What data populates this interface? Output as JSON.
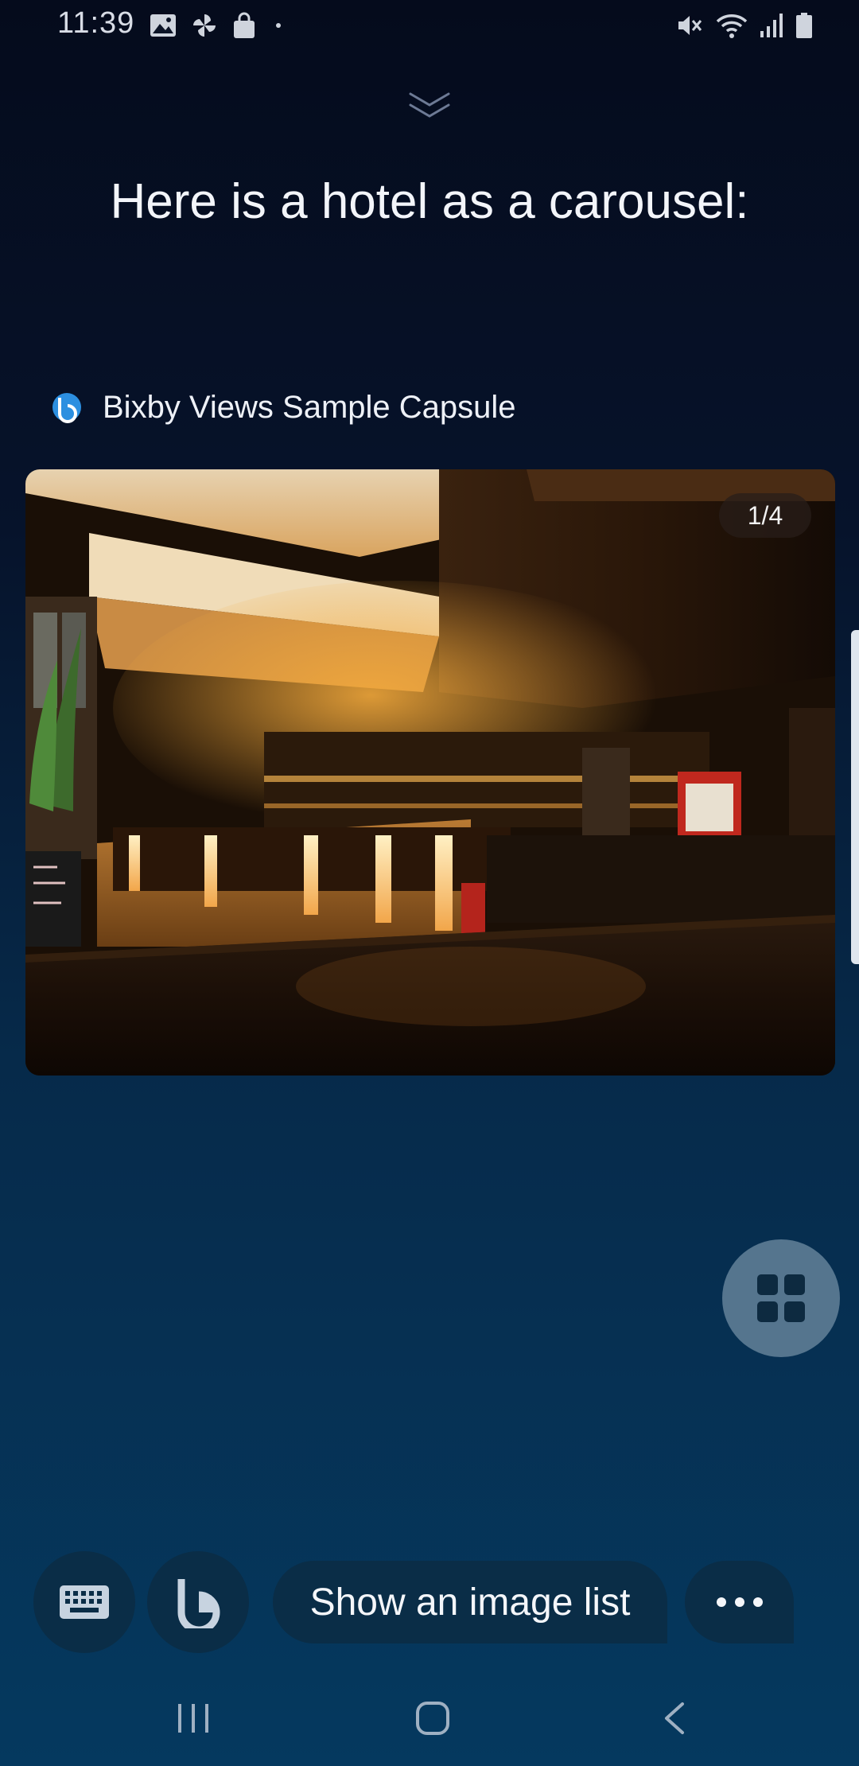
{
  "status_bar": {
    "time": "11:39",
    "left_icons": [
      "gallery-icon",
      "pinwheel-icon",
      "shopping-bag-icon",
      "dot-icon"
    ],
    "right_icons": [
      "mute-icon",
      "wifi-icon",
      "signal-icon",
      "battery-icon"
    ]
  },
  "headline": "Here is a hotel as a carousel:",
  "capsule": {
    "name": "Bixby Views Sample Capsule",
    "icon": "bixby-capsule-icon"
  },
  "carousel": {
    "page_indicator": "1/4",
    "current_index": 1,
    "total": 4,
    "image_description_icon": "hotel-bar-photo"
  },
  "actions": {
    "hint": "Show an image list",
    "keyboard_icon": "keyboard-icon",
    "bixby_icon": "bixby-icon",
    "more_icon": "more-icon",
    "grid_icon": "grid-icon"
  },
  "colors": {
    "chip_bg": "#0a2d47",
    "grid_btn_bg": "#55758e",
    "bg_top": "#050b1c",
    "bg_bottom": "#05395f"
  }
}
